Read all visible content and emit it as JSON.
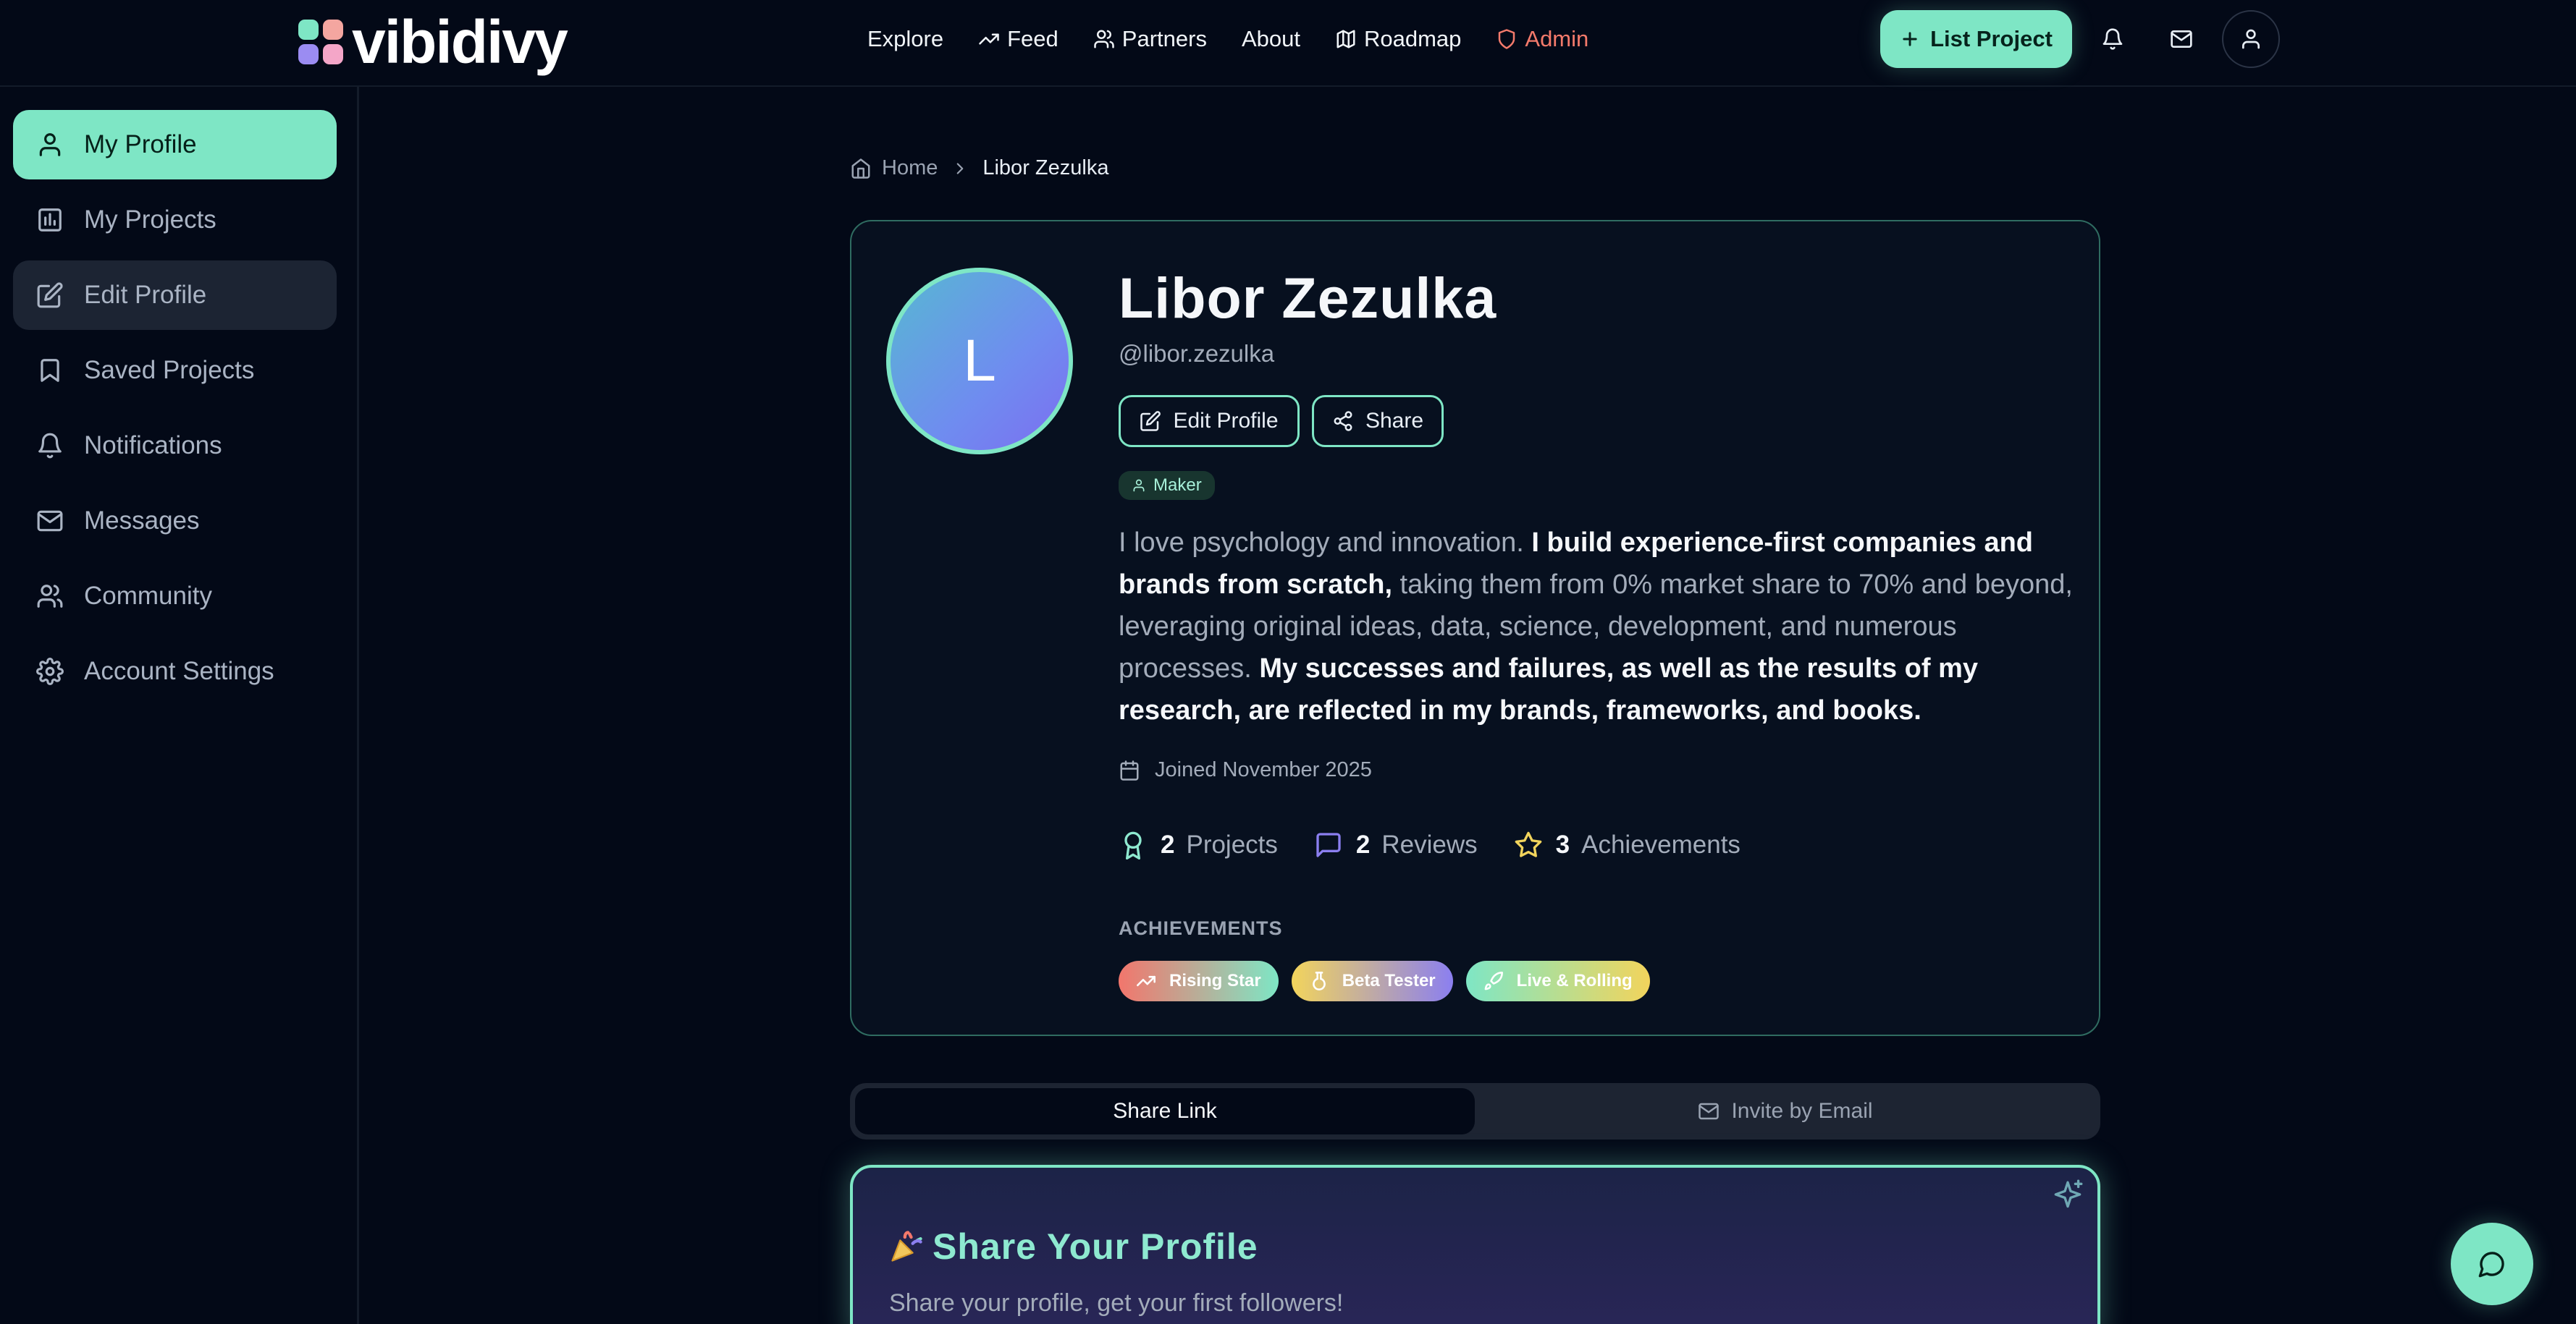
{
  "brand": {
    "name": "vibidivy",
    "colors": {
      "accent": "#7ee6c5",
      "background": "#030917",
      "admin": "#f47a6b"
    }
  },
  "nav": {
    "items": [
      {
        "label": "Explore",
        "icon": "none"
      },
      {
        "label": "Feed",
        "icon": "trending-up-icon"
      },
      {
        "label": "Partners",
        "icon": "users-icon"
      },
      {
        "label": "About",
        "icon": "none"
      },
      {
        "label": "Roadmap",
        "icon": "map-icon"
      },
      {
        "label": "Admin",
        "icon": "shield-icon"
      }
    ],
    "list_project": "List Project",
    "icons": [
      "bell-icon",
      "mail-icon",
      "user-icon"
    ]
  },
  "sidebar": {
    "items": [
      {
        "label": "My Profile",
        "icon": "user-icon",
        "state": "active"
      },
      {
        "label": "My Projects",
        "icon": "projects-icon",
        "state": "normal"
      },
      {
        "label": "Edit Profile",
        "icon": "edit-icon",
        "state": "hover"
      },
      {
        "label": "Saved Projects",
        "icon": "bookmark-icon",
        "state": "normal"
      },
      {
        "label": "Notifications",
        "icon": "bell-icon",
        "state": "normal"
      },
      {
        "label": "Messages",
        "icon": "mail-icon",
        "state": "normal"
      },
      {
        "label": "Community",
        "icon": "users-icon",
        "state": "normal"
      },
      {
        "label": "Account Settings",
        "icon": "gear-icon",
        "state": "normal"
      }
    ]
  },
  "breadcrumb": {
    "home": "Home",
    "current": "Libor Zezulka"
  },
  "profile": {
    "initial": "L",
    "name": "Libor Zezulka",
    "handle": "@libor.zezulka",
    "edit_label": "Edit Profile",
    "share_label": "Share",
    "role": "Maker",
    "bio": [
      {
        "text": "I love psychology and innovation. ",
        "bold": false
      },
      {
        "text": "I build experience-first companies and brands from scratch,",
        "bold": true
      },
      {
        "text": " taking them from 0% market share to 70% and beyond, leveraging original ideas, data, science, development, and numerous processes. ",
        "bold": false
      },
      {
        "text": "My successes and failures, as well as the results of my research, are reflected in my brands, frameworks, and books.",
        "bold": true
      }
    ],
    "joined": "Joined November 2025",
    "stats": [
      {
        "num": "2",
        "label": "Projects",
        "icon": "award-icon"
      },
      {
        "num": "2",
        "label": "Reviews",
        "icon": "message-icon"
      },
      {
        "num": "3",
        "label": "Achievements",
        "icon": "star-icon"
      }
    ],
    "achievements_heading": "ACHIEVEMENTS",
    "achievements": [
      {
        "label": "Rising Star",
        "icon": "trending-up-icon"
      },
      {
        "label": "Beta Tester",
        "icon": "flask-icon"
      },
      {
        "label": "Live & Rolling",
        "icon": "rocket-icon"
      }
    ]
  },
  "share_tabs": {
    "link": "Share Link",
    "email": "Invite by Email",
    "active": "Share Link"
  },
  "share_card": {
    "title": "Share Your Profile",
    "subtitle": "Share your profile, get your first followers!"
  }
}
